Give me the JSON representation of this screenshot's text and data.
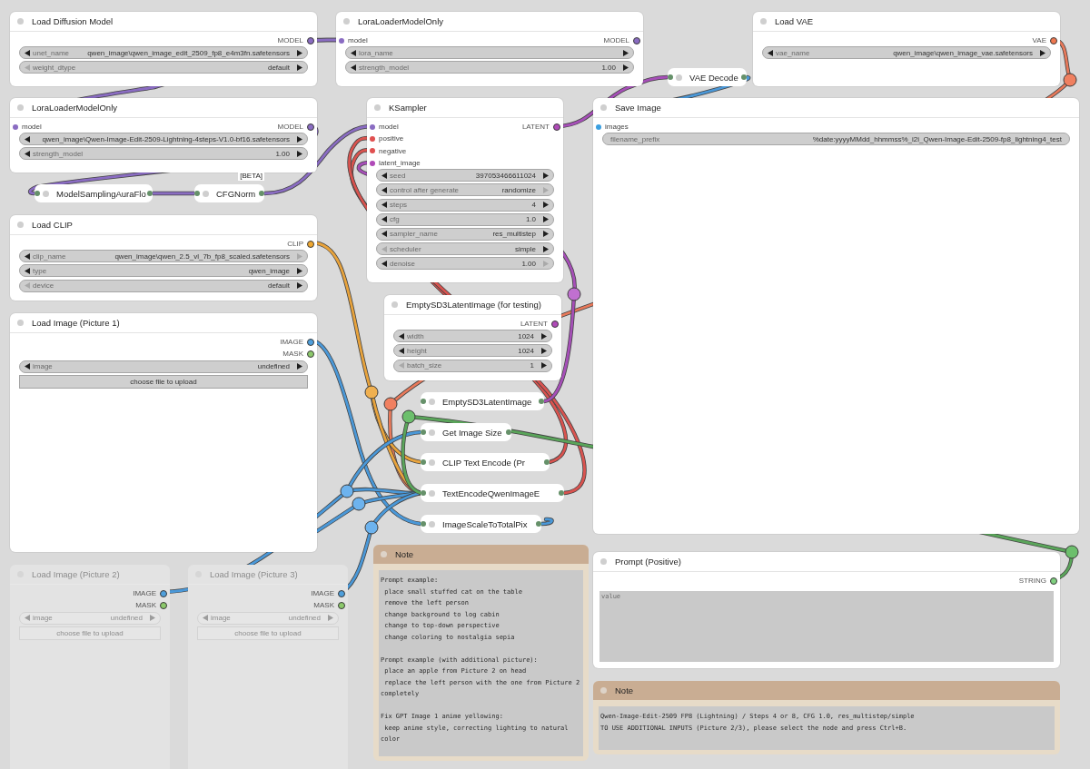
{
  "canvas": {
    "nodes": [
      {
        "kind": "node",
        "title": "Load Diffusion Model",
        "muted": false,
        "outputs": [
          {
            "label": "MODEL",
            "color": "#8a6cc2"
          }
        ],
        "widgets": [
          {
            "kind": "combo",
            "label": "unet_name",
            "value": "qwen_image\\qwen_image_edit_2509_fp8_e4m3fn.safetensors",
            "prev_disabled": false,
            "next_disabled": false
          },
          {
            "kind": "combo",
            "label": "weight_dtype",
            "value": "default",
            "prev_disabled": true,
            "next_disabled": false
          }
        ]
      },
      {
        "kind": "node",
        "title": "LoraLoaderModelOnly",
        "muted": false,
        "inputs": [
          {
            "label": "model",
            "color": "#8a6cc2"
          }
        ],
        "outputs": [
          {
            "label": "MODEL",
            "color": "#8a6cc2"
          }
        ],
        "widgets": [
          {
            "kind": "combo",
            "label": "lora_name",
            "prev_disabled": false,
            "next_disabled": false
          },
          {
            "kind": "number",
            "label": "strength_model",
            "value": "1.00",
            "prev_disabled": false,
            "next_disabled": false
          }
        ]
      },
      {
        "kind": "collapsed",
        "title": "VAE Decode",
        "muted": false
      },
      {
        "kind": "node",
        "title": "Load VAE",
        "muted": false,
        "outputs": [
          {
            "label": "VAE",
            "color": "#f07850"
          }
        ],
        "widgets": [
          {
            "kind": "combo",
            "label": "vae_name",
            "value": "qwen_image\\qwen_image_vae.safetensors",
            "prev_disabled": false,
            "next_disabled": false
          }
        ]
      },
      {
        "kind": "node",
        "title": "LoraLoaderModelOnly",
        "muted": false,
        "inputs": [
          {
            "label": "model",
            "color": "#8a6cc2"
          }
        ],
        "outputs": [
          {
            "label": "MODEL",
            "color": "#8a6cc2"
          }
        ],
        "widgets": [
          {
            "kind": "combo",
            "value": "qwen_image\\Qwen-Image-Edit-2509-Lightning-4steps-V1.0-bf16.safetensors",
            "prev_disabled": false,
            "next_disabled": false
          },
          {
            "kind": "number",
            "label": "strength_model",
            "value": "1.00",
            "prev_disabled": false,
            "next_disabled": false
          }
        ]
      },
      {
        "kind": "node",
        "title": "KSampler",
        "muted": false,
        "inputs": [
          {
            "label": "model",
            "color": "#8a6cc2"
          },
          {
            "label": "positive",
            "color": "#e05050"
          },
          {
            "label": "negative",
            "color": "#e05050"
          },
          {
            "label": "latent_image",
            "color": "#b04ab8"
          }
        ],
        "outputs": [
          {
            "label": "LATENT",
            "color": "#b04ab8"
          }
        ],
        "widgets": [
          {
            "kind": "number",
            "label": "seed",
            "value": "397053466611024",
            "prev_disabled": false,
            "next_disabled": false
          },
          {
            "kind": "combo",
            "label": "control after generate",
            "value": "randomize",
            "prev_disabled": false,
            "next_disabled": true
          },
          {
            "kind": "number",
            "label": "steps",
            "value": "4",
            "prev_disabled": false,
            "next_disabled": false
          },
          {
            "kind": "number",
            "label": "cfg",
            "value": "1.0",
            "prev_disabled": false,
            "next_disabled": false
          },
          {
            "kind": "combo",
            "label": "sampler_name",
            "value": "res_multistep",
            "prev_disabled": false,
            "next_disabled": false
          },
          {
            "kind": "combo",
            "label": "scheduler",
            "value": "simple",
            "prev_disabled": true,
            "next_disabled": false
          },
          {
            "kind": "number",
            "label": "denoise",
            "value": "1.00",
            "prev_disabled": false,
            "next_disabled": true
          }
        ]
      },
      {
        "kind": "node",
        "title": "Save Image",
        "muted": false,
        "inputs": [
          {
            "label": "images",
            "color": "#3b9fe0"
          }
        ],
        "widgets": [
          {
            "kind": "text",
            "label": "filename_prefix",
            "value": "%date:yyyyMMdd_hhmmss%_i2i_Qwen-Image-Edit-2509-fp8_lightning4_test"
          }
        ]
      },
      {
        "kind": "collapsed",
        "title": "ModelSamplingAuraFlo",
        "muted": false
      },
      {
        "kind": "collapsed",
        "title": "CFGNorm",
        "badge": "[BETA]",
        "muted": false
      },
      {
        "kind": "node",
        "title": "Load CLIP",
        "muted": false,
        "outputs": [
          {
            "label": "CLIP",
            "color": "#f0a830"
          }
        ],
        "widgets": [
          {
            "kind": "combo",
            "label": "clip_name",
            "value": "qwen_image\\qwen_2.5_vl_7b_fp8_scaled.safetensors",
            "prev_disabled": false,
            "next_disabled": true
          },
          {
            "kind": "combo",
            "label": "type",
            "value": "qwen_image",
            "prev_disabled": false,
            "next_disabled": false
          },
          {
            "kind": "combo",
            "label": "device",
            "value": "default",
            "prev_disabled": true,
            "next_disabled": false
          }
        ]
      },
      {
        "kind": "node",
        "title": "EmptySD3LatentImage (for testing)",
        "muted": false,
        "outputs": [
          {
            "label": "LATENT",
            "color": "#b04ab8"
          }
        ],
        "widgets": [
          {
            "kind": "number",
            "label": "width",
            "value": "1024",
            "prev_disabled": false,
            "next_disabled": false
          },
          {
            "kind": "number",
            "label": "height",
            "value": "1024",
            "prev_disabled": false,
            "next_disabled": false
          },
          {
            "kind": "number",
            "label": "batch_size",
            "value": "1",
            "prev_disabled": true,
            "next_disabled": false
          }
        ]
      },
      {
        "kind": "node",
        "title": "Load Image (Picture 1)",
        "muted": false,
        "outputs": [
          {
            "label": "IMAGE",
            "color": "#4e9fdc"
          },
          {
            "label": "MASK",
            "color": "#8cc96b"
          }
        ],
        "widgets": [
          {
            "kind": "combo",
            "label": "image",
            "value": "undefined",
            "prev_disabled": false,
            "next_disabled": false
          },
          {
            "kind": "button",
            "label": "choose file to upload"
          }
        ]
      },
      {
        "kind": "collapsed",
        "title": "EmptySD3LatentImage",
        "muted": false
      },
      {
        "kind": "collapsed",
        "title": "Get Image Size",
        "muted": false
      },
      {
        "kind": "collapsed",
        "title": "CLIP Text Encode (Pr",
        "muted": false
      },
      {
        "kind": "collapsed",
        "title": "TextEncodeQwenImageE",
        "muted": false
      },
      {
        "kind": "collapsed",
        "title": "ImageScaleToTotalPix",
        "muted": false
      },
      {
        "kind": "note",
        "title": "Note",
        "muted": false,
        "text": "Prompt example:\n place small stuffed cat on the table\n remove the left person\n change background to log cabin\n change to top-down perspective\n change coloring to nostalgia sepia\n\nPrompt example (with additional picture):\n place an apple from Picture 2 on head\n replace the left person with the one from Picture 2 completely\n\nFix GPT Image 1 anime yellowing:\n keep anime style, correcting lighting to natural color"
      },
      {
        "kind": "node",
        "title": "Prompt (Positive)",
        "muted": false,
        "outputs": [
          {
            "label": "STRING",
            "color": "#7fd07f"
          }
        ],
        "widgets": [
          {
            "kind": "textarea",
            "placeholder": "value"
          }
        ]
      },
      {
        "kind": "node",
        "title": "Load Image (Picture 2)",
        "muted": true,
        "outputs": [
          {
            "label": "IMAGE",
            "color": "#4e9fdc"
          },
          {
            "label": "MASK",
            "color": "#8cc96b"
          }
        ],
        "widgets": [
          {
            "kind": "combo",
            "label": "image",
            "value": "undefined",
            "prev_disabled": false,
            "next_disabled": false
          },
          {
            "kind": "button",
            "label": "choose file to upload"
          }
        ]
      },
      {
        "kind": "node",
        "title": "Load Image (Picture 3)",
        "muted": true,
        "outputs": [
          {
            "label": "IMAGE",
            "color": "#4e9fdc"
          },
          {
            "label": "MASK",
            "color": "#8cc96b"
          }
        ],
        "widgets": [
          {
            "kind": "combo",
            "label": "image",
            "value": "undefined",
            "prev_disabled": false,
            "next_disabled": false
          },
          {
            "kind": "button",
            "label": "choose file to upload"
          }
        ]
      },
      {
        "kind": "note",
        "title": "Note",
        "muted": false,
        "text": "Qwen-Image-Edit-2509 FP8 (Lightning) / Steps 4 or 8, CFG 1.0, res_multistep/simple\nTO USE ADDITIONAL INPUTS (Picture 2/3), please select the node and press Ctrl+B."
      }
    ]
  }
}
